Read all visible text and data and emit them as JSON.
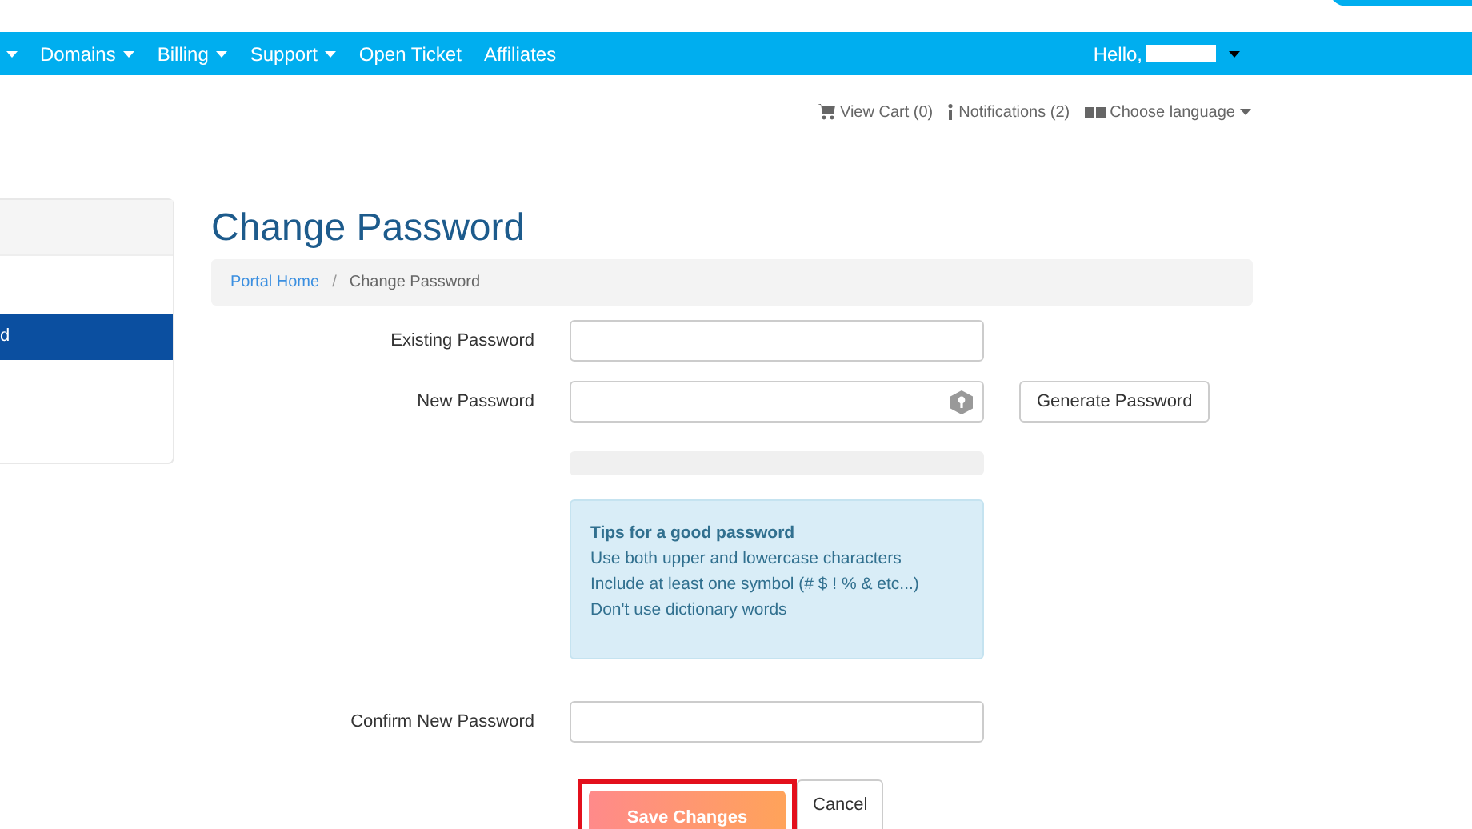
{
  "navbar": {
    "items": [
      {
        "has_caret": true
      },
      {
        "label": "Domains",
        "has_caret": true
      },
      {
        "label": "Billing",
        "has_caret": true
      },
      {
        "label": "Support",
        "has_caret": true
      },
      {
        "label": "Open Ticket",
        "has_caret": false
      },
      {
        "label": "Affiliates",
        "has_caret": false
      }
    ],
    "user": {
      "greeting": "Hello,",
      "name_redacted": true
    }
  },
  "utility_links": [
    {
      "kind": "cart",
      "label": "View Cart (0)"
    },
    {
      "kind": "info",
      "label": "Notifications (2)"
    },
    {
      "kind": "language",
      "label": "Choose language"
    }
  ],
  "sidebar": {
    "items": [
      {
        "label": "d",
        "selected": true
      }
    ]
  },
  "page": {
    "title": "Change Password",
    "breadcrumb_separator": "/",
    "breadcrumb": [
      {
        "label": "Portal Home",
        "link": true
      },
      {
        "label": "Change Password",
        "link": false
      }
    ]
  },
  "form": {
    "fields": [
      {
        "kind": "text",
        "label": "Existing Password"
      },
      {
        "kind": "generate",
        "label": "New Password",
        "button": "Generate Password"
      },
      {
        "kind": "meter",
        "level": 0
      },
      {
        "kind": "tips",
        "title": "Tips for a good password",
        "lines": [
          "Use both upper and lowercase characters",
          "Include at least one symbol (# $ ! % & etc...)",
          "Don't use dictionary words"
        ]
      },
      {
        "kind": "text",
        "label": "Confirm New Password"
      }
    ],
    "buttons": [
      {
        "label": "Save Changes",
        "primary": true,
        "highlighted": true
      },
      {
        "label": "Cancel",
        "primary": false,
        "highlighted": false
      }
    ]
  }
}
